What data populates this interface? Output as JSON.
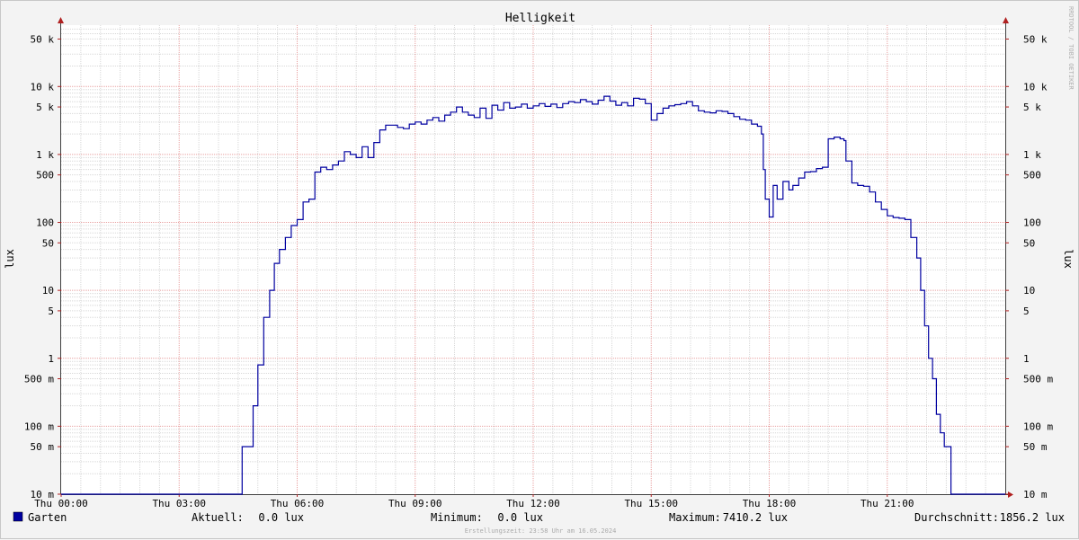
{
  "chart_data": {
    "type": "line",
    "title": "Helligkeit",
    "ylabel": "lux",
    "y_scale": "log",
    "ylim": [
      0.01,
      80000
    ],
    "xlim": [
      "00:00",
      "24:00"
    ],
    "grid": true,
    "side_label": "RRDTOOL / TOBI OETIKER",
    "x_ticks": [
      {
        "t": 0,
        "label": "Thu 00:00"
      },
      {
        "t": 3,
        "label": "Thu 03:00"
      },
      {
        "t": 6,
        "label": "Thu 06:00"
      },
      {
        "t": 9,
        "label": "Thu 09:00"
      },
      {
        "t": 12,
        "label": "Thu 12:00"
      },
      {
        "t": 15,
        "label": "Thu 15:00"
      },
      {
        "t": 18,
        "label": "Thu 18:00"
      },
      {
        "t": 21,
        "label": "Thu 21:00"
      }
    ],
    "y_ticks": [
      {
        "v": 0.01,
        "label": "10 m"
      },
      {
        "v": 0.05,
        "label": "50 m"
      },
      {
        "v": 0.1,
        "label": "100 m"
      },
      {
        "v": 0.5,
        "label": "500 m"
      },
      {
        "v": 1,
        "label": "1"
      },
      {
        "v": 5,
        "label": "5"
      },
      {
        "v": 10,
        "label": "10"
      },
      {
        "v": 50,
        "label": "50"
      },
      {
        "v": 100,
        "label": "100"
      },
      {
        "v": 500,
        "label": "500"
      },
      {
        "v": 1000,
        "label": "1 k"
      },
      {
        "v": 5000,
        "label": "5 k"
      },
      {
        "v": 10000,
        "label": "10 k"
      },
      {
        "v": 50000,
        "label": "50 k"
      }
    ],
    "series": [
      {
        "name": "Garten",
        "color": "#0000a0",
        "x_unit": "hours",
        "points": [
          [
            0,
            0.01
          ],
          [
            4.58,
            0.01
          ],
          [
            4.6,
            0.05
          ],
          [
            4.8,
            0.05
          ],
          [
            4.88,
            0.2
          ],
          [
            5.0,
            0.8
          ],
          [
            5.15,
            4
          ],
          [
            5.3,
            10
          ],
          [
            5.42,
            25
          ],
          [
            5.55,
            40
          ],
          [
            5.7,
            60
          ],
          [
            5.85,
            90
          ],
          [
            6.0,
            110
          ],
          [
            6.15,
            200
          ],
          [
            6.3,
            220
          ],
          [
            6.45,
            550
          ],
          [
            6.6,
            650
          ],
          [
            6.75,
            600
          ],
          [
            6.9,
            700
          ],
          [
            7.05,
            800
          ],
          [
            7.2,
            1100
          ],
          [
            7.35,
            1000
          ],
          [
            7.5,
            900
          ],
          [
            7.65,
            1300
          ],
          [
            7.8,
            900
          ],
          [
            7.95,
            1500
          ],
          [
            8.1,
            2300
          ],
          [
            8.25,
            2700
          ],
          [
            8.4,
            2700
          ],
          [
            8.55,
            2500
          ],
          [
            8.7,
            2400
          ],
          [
            8.85,
            2800
          ],
          [
            9.0,
            3000
          ],
          [
            9.15,
            2800
          ],
          [
            9.3,
            3200
          ],
          [
            9.45,
            3500
          ],
          [
            9.6,
            3100
          ],
          [
            9.75,
            3800
          ],
          [
            9.9,
            4200
          ],
          [
            10.05,
            5000
          ],
          [
            10.2,
            4200
          ],
          [
            10.35,
            3800
          ],
          [
            10.5,
            3500
          ],
          [
            10.65,
            4800
          ],
          [
            10.8,
            3400
          ],
          [
            10.95,
            5300
          ],
          [
            11.1,
            4500
          ],
          [
            11.25,
            5800
          ],
          [
            11.4,
            4800
          ],
          [
            11.55,
            5000
          ],
          [
            11.7,
            5500
          ],
          [
            11.85,
            4800
          ],
          [
            12.0,
            5200
          ],
          [
            12.15,
            5600
          ],
          [
            12.3,
            5100
          ],
          [
            12.45,
            5500
          ],
          [
            12.6,
            4900
          ],
          [
            12.75,
            5600
          ],
          [
            12.9,
            6000
          ],
          [
            13.05,
            5800
          ],
          [
            13.2,
            6400
          ],
          [
            13.35,
            6000
          ],
          [
            13.5,
            5500
          ],
          [
            13.65,
            6300
          ],
          [
            13.8,
            7200
          ],
          [
            13.95,
            6100
          ],
          [
            14.1,
            5300
          ],
          [
            14.25,
            5800
          ],
          [
            14.4,
            5200
          ],
          [
            14.55,
            6700
          ],
          [
            14.7,
            6500
          ],
          [
            14.85,
            5600
          ],
          [
            15.0,
            3200
          ],
          [
            15.15,
            4000
          ],
          [
            15.3,
            4800
          ],
          [
            15.45,
            5200
          ],
          [
            15.6,
            5400
          ],
          [
            15.75,
            5600
          ],
          [
            15.9,
            6000
          ],
          [
            16.05,
            5200
          ],
          [
            16.2,
            4400
          ],
          [
            16.35,
            4200
          ],
          [
            16.5,
            4100
          ],
          [
            16.65,
            4400
          ],
          [
            16.8,
            4300
          ],
          [
            16.95,
            4000
          ],
          [
            17.1,
            3600
          ],
          [
            17.25,
            3300
          ],
          [
            17.4,
            3200
          ],
          [
            17.55,
            2800
          ],
          [
            17.7,
            2600
          ],
          [
            17.8,
            2000
          ],
          [
            17.85,
            600
          ],
          [
            17.9,
            220
          ],
          [
            18.0,
            120
          ],
          [
            18.1,
            350
          ],
          [
            18.2,
            220
          ],
          [
            18.35,
            400
          ],
          [
            18.5,
            300
          ],
          [
            18.6,
            350
          ],
          [
            18.75,
            450
          ],
          [
            18.9,
            550
          ],
          [
            19.05,
            560
          ],
          [
            19.2,
            620
          ],
          [
            19.35,
            650
          ],
          [
            19.5,
            1700
          ],
          [
            19.65,
            1800
          ],
          [
            19.8,
            1700
          ],
          [
            19.9,
            1600
          ],
          [
            19.95,
            800
          ],
          [
            20.1,
            380
          ],
          [
            20.25,
            350
          ],
          [
            20.4,
            340
          ],
          [
            20.55,
            280
          ],
          [
            20.7,
            200
          ],
          [
            20.85,
            155
          ],
          [
            21.0,
            125
          ],
          [
            21.15,
            118
          ],
          [
            21.3,
            115
          ],
          [
            21.45,
            110
          ],
          [
            21.6,
            60
          ],
          [
            21.75,
            30
          ],
          [
            21.85,
            10
          ],
          [
            21.95,
            3
          ],
          [
            22.05,
            1
          ],
          [
            22.15,
            0.5
          ],
          [
            22.25,
            0.15
          ],
          [
            22.35,
            0.08
          ],
          [
            22.45,
            0.05
          ],
          [
            22.6,
            0.05
          ],
          [
            22.62,
            0.01
          ],
          [
            24,
            0.01
          ]
        ]
      }
    ]
  },
  "legend": {
    "series_label": "Garten",
    "series_color": "#0000a0",
    "aktuell_label": "Aktuell:",
    "aktuell_value": "0.0 lux",
    "minimum_label": "Minimum:",
    "minimum_value": "0.0 lux",
    "maximum_label": "Maximum:",
    "maximum_value": "7410.2 lux",
    "durchschnitt_label": "Durchschnitt:",
    "durchschnitt_value": "1856.2 lux"
  },
  "footer": {
    "timestamp": "Erstellungszeit: 23:58 Uhr am 16.05.2024"
  }
}
